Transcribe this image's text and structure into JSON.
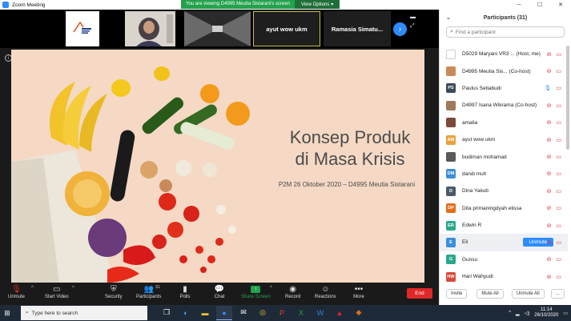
{
  "window": {
    "title": "Zoom Meeting",
    "controls": [
      "minimize-icon",
      "maximize-icon",
      "close-icon"
    ]
  },
  "viewing_banner": {
    "message": "You are viewing D4995 Meutia Sistarani's screen",
    "options_label": "View Options"
  },
  "video_strip": {
    "tiles": [
      {
        "type": "logo",
        "name": "logo-tile"
      },
      {
        "type": "video",
        "name": "person-tile"
      },
      {
        "type": "video",
        "name": "hallway-tile"
      },
      {
        "type": "name",
        "label": "ayut wow ukm"
      },
      {
        "type": "name",
        "label": "Ramasia  Simatu..."
      }
    ]
  },
  "slide": {
    "title_line1": "Konsep Produk",
    "title_line2": "di Masa Krisis",
    "subtitle": "P2M 26 Oktober 2020 – D4995 Meutia Sistarani"
  },
  "toolbar": {
    "unmute": "Unmute",
    "start_video": "Start Video",
    "security": "Security",
    "participants": "Participants",
    "participants_count": "31",
    "polls": "Polls",
    "chat": "Chat",
    "share_screen": "Share Screen",
    "record": "Record",
    "reactions": "Reactions",
    "more": "More",
    "end": "End"
  },
  "panel": {
    "title": "Participants (31)",
    "search_placeholder": "Find a participant",
    "participants": [
      {
        "name": "D5029 Maryani VR3 ... (Host, me)",
        "initials": "",
        "color": "#ffffff",
        "mic": "off",
        "cam": "off"
      },
      {
        "name": "D4995 Meutia Sis... (Co-host)",
        "initials": "",
        "color": "#c98a57",
        "mic": "off",
        "cam": "off"
      },
      {
        "name": "Paulus Setiabudi",
        "initials": "PS",
        "color": "#3a4a5c",
        "mic": "on",
        "cam": "off"
      },
      {
        "name": "D4997 Isana Wikrama (Co-host)",
        "initials": "",
        "color": "#a0785a",
        "mic": "off",
        "cam": "off"
      },
      {
        "name": "amalia",
        "initials": "",
        "color": "#7a4a3a",
        "mic": "off",
        "cam": "off"
      },
      {
        "name": "ayut wow ukm",
        "initials": "AW",
        "color": "#e8a23a",
        "mic": "off",
        "cam": "off"
      },
      {
        "name": "budiman mohamad",
        "initials": "",
        "color": "#5a5a5a",
        "mic": "off",
        "cam": "off"
      },
      {
        "name": "dandi muh",
        "initials": "DM",
        "color": "#3a8fd8",
        "mic": "off",
        "cam": "off"
      },
      {
        "name": "Dina Yakub",
        "initials": "D",
        "color": "#4a5a6a",
        "mic": "off",
        "cam": "off"
      },
      {
        "name": "Dita primaningdyah elissa",
        "initials": "DP",
        "color": "#e0701a",
        "mic": "off",
        "cam": "off"
      },
      {
        "name": "Edwin R",
        "initials": "ER",
        "color": "#2aa88a",
        "mic": "off",
        "cam": "off"
      },
      {
        "name": "Eli",
        "initials": "E",
        "color": "#3a8fd8",
        "mic": "off",
        "cam": "off",
        "unmute_label": "Unmute"
      },
      {
        "name": "Gunsu",
        "initials": "G",
        "color": "#2aa88a",
        "mic": "off",
        "cam": "off"
      },
      {
        "name": "Hari Wahyudi",
        "initials": "HW",
        "color": "#d84a3a",
        "mic": "off",
        "cam": "off"
      }
    ],
    "footer": {
      "invite": "Invite",
      "mute_all": "Mute All",
      "unmute_all": "Unmute All",
      "more": "..."
    }
  },
  "taskbar": {
    "search_placeholder": "Type here to search",
    "time": "11:14",
    "date": "26/10/2020"
  },
  "colors": {
    "zoom_blue": "#2d8cff",
    "green": "#23a24d",
    "end_red": "#e02828",
    "slide_bg": "#f5d9c4"
  }
}
